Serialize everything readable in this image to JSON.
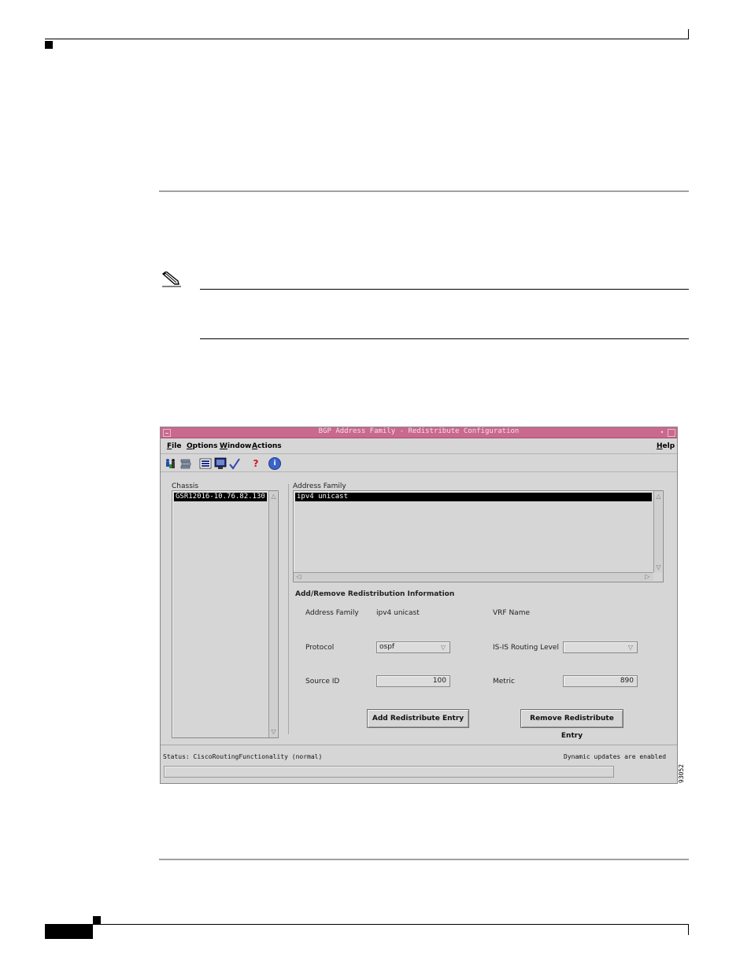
{
  "window": {
    "title": "BGP Address Family - Redistribute Configuration",
    "minimize_glyph": "•"
  },
  "menu": {
    "file": "File",
    "options": "Options",
    "window": "Window",
    "actions": "Actions",
    "help": "Help"
  },
  "toolbar": {
    "icons": [
      "people-icon",
      "stack-icon",
      "list-icon",
      "monitor-icon",
      "checkmark-icon",
      "help-icon",
      "info-icon"
    ],
    "help_glyph": "?",
    "info_glyph": "i"
  },
  "chassis": {
    "label": "Chassis",
    "items": [
      "GSR12016-10.76.82.130"
    ]
  },
  "address_family_list": {
    "label": "Address Family",
    "items": [
      "ipv4 unicast"
    ]
  },
  "scroll": {
    "up": "△",
    "down": "▽",
    "left": "◁",
    "right": "▷"
  },
  "redistribution": {
    "section_title": "Add/Remove Redistribution Information",
    "address_family_label": "Address Family",
    "address_family_value": "ipv4 unicast",
    "vrf_label": "VRF Name",
    "vrf_value": "",
    "protocol_label": "Protocol",
    "protocol_value": "ospf",
    "isis_label": "IS-IS Routing Level",
    "isis_value": "",
    "source_id_label": "Source ID",
    "source_id_value": "100",
    "metric_label": "Metric",
    "metric_value": "890",
    "combo_arrow": "▽",
    "add_button": "Add Redistribute Entry",
    "remove_button": "Remove Redistribute Entry"
  },
  "status": {
    "left": "Status: CiscoRoutingFunctionality (normal)",
    "right": "Dynamic updates are enabled",
    "progress": 0
  },
  "figure_id": "93052",
  "colors": {
    "titlebar": "#c9698e",
    "window_bg": "#d6d6d6",
    "selection": "#000000",
    "rule": "#a0a0a0"
  }
}
